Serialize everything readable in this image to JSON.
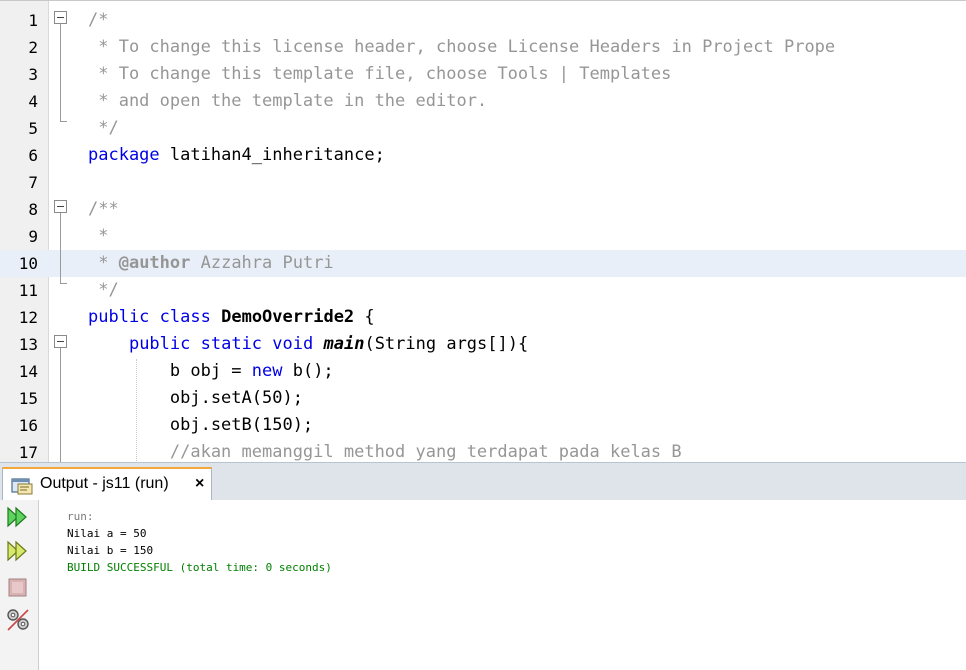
{
  "editor": {
    "line_numbers": [
      "1",
      "2",
      "3",
      "4",
      "5",
      "6",
      "7",
      "8",
      "9",
      "10",
      "11",
      "12",
      "13",
      "14",
      "15",
      "16",
      "17"
    ],
    "lines": [
      [
        {
          "t": "/*",
          "c": "c"
        }
      ],
      [
        {
          "t": " * To change this license header, choose License Headers in Project Prope",
          "c": "c"
        }
      ],
      [
        {
          "t": " * To change this template file, choose Tools | Templates",
          "c": "c"
        }
      ],
      [
        {
          "t": " * and open the template in the editor.",
          "c": "c"
        }
      ],
      [
        {
          "t": " */",
          "c": "c"
        }
      ],
      [
        {
          "t": "package",
          "c": "k"
        },
        {
          "t": " latihan4_inheritance;",
          "c": "n"
        }
      ],
      [],
      [
        {
          "t": "/**",
          "c": "c"
        }
      ],
      [
        {
          "t": " *",
          "c": "c"
        }
      ],
      [
        {
          "t": " * ",
          "c": "c"
        },
        {
          "t": "@author",
          "c": "cb"
        },
        {
          "t": " Azzahra Putri",
          "c": "c"
        }
      ],
      [
        {
          "t": " */",
          "c": "c"
        }
      ],
      [
        {
          "t": "public",
          "c": "k"
        },
        {
          "t": " ",
          "c": "n"
        },
        {
          "t": "class",
          "c": "k"
        },
        {
          "t": " ",
          "c": "n"
        },
        {
          "t": "DemoOverride2",
          "c": "b"
        },
        {
          "t": " {",
          "c": "n"
        }
      ],
      [
        {
          "t": "    ",
          "c": "n"
        },
        {
          "t": "public",
          "c": "k"
        },
        {
          "t": " ",
          "c": "n"
        },
        {
          "t": "static",
          "c": "k"
        },
        {
          "t": " ",
          "c": "n"
        },
        {
          "t": "void",
          "c": "k"
        },
        {
          "t": " ",
          "c": "n"
        },
        {
          "t": "main",
          "c": "bi"
        },
        {
          "t": "(String args[]){",
          "c": "n"
        }
      ],
      [
        {
          "t": "        b obj = ",
          "c": "n"
        },
        {
          "t": "new",
          "c": "k"
        },
        {
          "t": " b();",
          "c": "n"
        }
      ],
      [
        {
          "t": "        obj.setA(50);",
          "c": "n"
        }
      ],
      [
        {
          "t": "        obj.setB(150);",
          "c": "n"
        }
      ],
      [
        {
          "t": "        //akan memanggil method yang terdapat pada kelas B",
          "c": "c"
        }
      ]
    ]
  },
  "output": {
    "tab_label": "Output - js11 (run)",
    "close_glyph": "×",
    "console": [
      {
        "t": "run:",
        "c": "o-gray"
      },
      {
        "t": "Nilai a = 50",
        "c": "o-black"
      },
      {
        "t": "Nilai b = 150",
        "c": "o-black"
      },
      {
        "t": "BUILD SUCCESSFUL (total time: 0 seconds)",
        "c": "o-green"
      }
    ],
    "toolbar": [
      {
        "name": "rerun-icon",
        "label": "rerun"
      },
      {
        "name": "rerun-with-options-icon",
        "label": "rerun with options"
      },
      {
        "name": "stop-icon",
        "label": "stop"
      },
      {
        "name": "settings-icon",
        "label": "settings"
      }
    ]
  },
  "colors": {
    "keyword": "#0000e6",
    "comment": "#969696",
    "success": "#008000",
    "highlight_line": "#e9eff8",
    "tab_accent": "#f2a83b"
  }
}
